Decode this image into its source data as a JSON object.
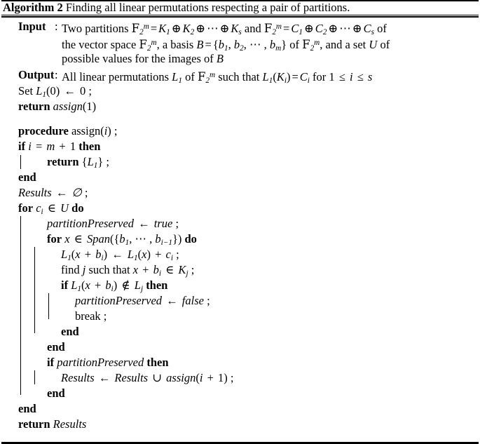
{
  "caption": {
    "label": "Algorithm 2",
    "text": "Finding all linear permutations respecting a pair of partitions."
  },
  "io": {
    "input_label": "Input",
    "output_label": "Output",
    "colon": ":",
    "input_lines": [
      "Two partitions F₂ᵐ = K₁ ⊕ K₂ ⊕ ⋯ ⊕ K_s and F₂ᵐ = C₁ ⊕ C₂ ⊕ ⋯ ⊕ C_s of",
      "the vector space F₂ᵐ, a basis B = {b₁, b₂, ⋯ , b_m} of F₂ᵐ, and a set U of",
      "possible values for the images of B"
    ],
    "output_lines": [
      "All linear permutations L₁ of F₂ᵐ such that L₁(K_i) = C_i for 1 ≤ i ≤ s"
    ]
  },
  "code": {
    "l1": "Set L₁(0) ← 0 ;",
    "l2": "return assign(1)",
    "l3": "procedure assign(i) ;",
    "l4": "if i = m + 1 then",
    "l5": "return {L₁} ;",
    "l6": "end",
    "l7": "Results ← ∅ ;",
    "l8": "for c_i ∈ U do",
    "l9": "partitionPreserved ← true ;",
    "l10": "for x ∈ Span({b₁, ⋯ , b_{i−1}}) do",
    "l11": "L₁(x + b_i) ← L₁(x) + c_i ;",
    "l12": "find j such that x + b_i ∈ K_j ;",
    "l13": "if L₁(x + b_i) ∉ L_j then",
    "l14": "partitionPreserved ← false ;",
    "l15": "break ;",
    "l16": "end",
    "l17": "end",
    "l18": "if partitionPreserved then",
    "l19": "Results ← Results ∪ assign(i + 1) ;",
    "l20": "end",
    "l21": "end",
    "l22": "return Results"
  },
  "keywords": {
    "set": "Set",
    "return": "return",
    "procedure": "procedure",
    "if": "if",
    "then": "then",
    "end": "end",
    "for": "for",
    "do": "do",
    "break": "break",
    "find": "find",
    "such_that": "such that",
    "true": "true",
    "false": "false"
  },
  "symbols": {
    "assign_arrow": "←",
    "oplus": "⊕",
    "in": "∈",
    "notin": "∉",
    "emptyset": "∅",
    "union": "∪",
    "leq": "≤",
    "cdots": "⋯",
    "equals": "=",
    "plus": "+"
  },
  "colors": {
    "text": "#000000",
    "background": "#ffffff",
    "rule": "#000000"
  }
}
